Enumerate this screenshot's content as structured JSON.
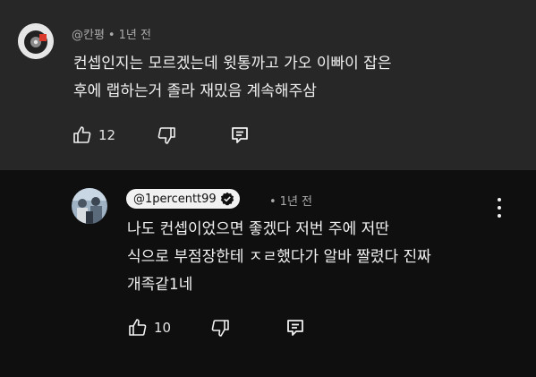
{
  "comment": {
    "author": "@칸평",
    "time": "1년 전",
    "lines": [
      "컨셉인지는 모르겠는데 윗통까고 가오 이빠이 잡은",
      "후에 랩하는거 졸라 재밌음 계속해주삼"
    ],
    "likes": "12"
  },
  "reply": {
    "author": "@1percentt99",
    "time": "1년 전",
    "lines": [
      "나도 컨셉이었으면 좋겠다 저번 주에 저딴",
      "식으로 부점장한테 ㅈㄹ했다가 알바 짤렸다 진짜",
      "개족같1네"
    ],
    "likes": "10"
  },
  "icons": {
    "like": "thumbs-up-icon",
    "dislike": "thumbs-down-icon",
    "reply": "reply-comment-icon",
    "more": "more-vertical-icon",
    "verified": "verified-badge-icon"
  },
  "colors": {
    "top_background": "#272727",
    "page_background": "#0f0f0f",
    "meta_text": "#aaaaaa",
    "badge_background": "#f1f1f1"
  }
}
